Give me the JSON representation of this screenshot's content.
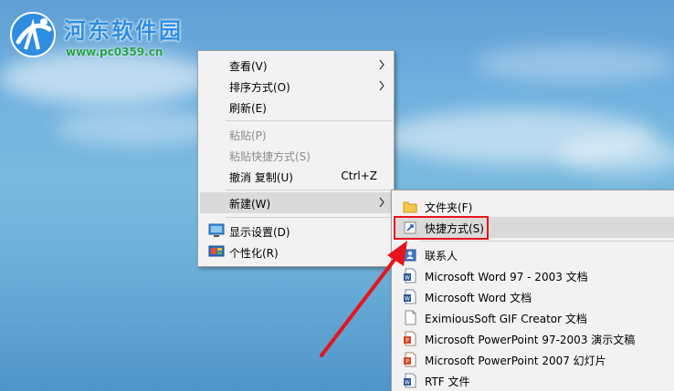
{
  "watermark": {
    "title": "河东软件园",
    "url": "www.pc0359.cn"
  },
  "context_menu": {
    "view_label": "查看(V)",
    "sort_label": "排序方式(O)",
    "refresh_label": "刷新(E)",
    "paste_label": "粘贴(P)",
    "paste_shortcut_label": "粘贴快捷方式(S)",
    "undo_label": "撤消 复制(U)",
    "undo_shortcut": "Ctrl+Z",
    "new_label": "新建(W)",
    "display_label": "显示设置(D)",
    "personalize_label": "个性化(R)"
  },
  "new_submenu": {
    "items": [
      {
        "label": "文件夹(F)",
        "icon": "folder-icon"
      },
      {
        "label": "快捷方式(S)",
        "icon": "shortcut-icon"
      },
      {
        "label": "联系人",
        "icon": "contact-icon"
      },
      {
        "label": "Microsoft Word 97 - 2003 文档",
        "icon": "word-doc-icon"
      },
      {
        "label": "Microsoft Word 文档",
        "icon": "word-doc-icon"
      },
      {
        "label": "EximiousSoft GIF Creator 文档",
        "icon": "blank-file-icon"
      },
      {
        "label": "Microsoft PowerPoint 97-2003 演示文稿",
        "icon": "powerpoint-icon"
      },
      {
        "label": "Microsoft PowerPoint 2007 幻灯片",
        "icon": "powerpoint-icon"
      },
      {
        "label": "RTF 文件",
        "icon": "word-doc-icon"
      }
    ]
  },
  "colors": {
    "menu_background": "#f2f2f2",
    "menu_hover": "#dadada",
    "annotation_red": "#e8141c",
    "watermark_blue": "#2f8de0",
    "watermark_green": "#26a24a"
  }
}
